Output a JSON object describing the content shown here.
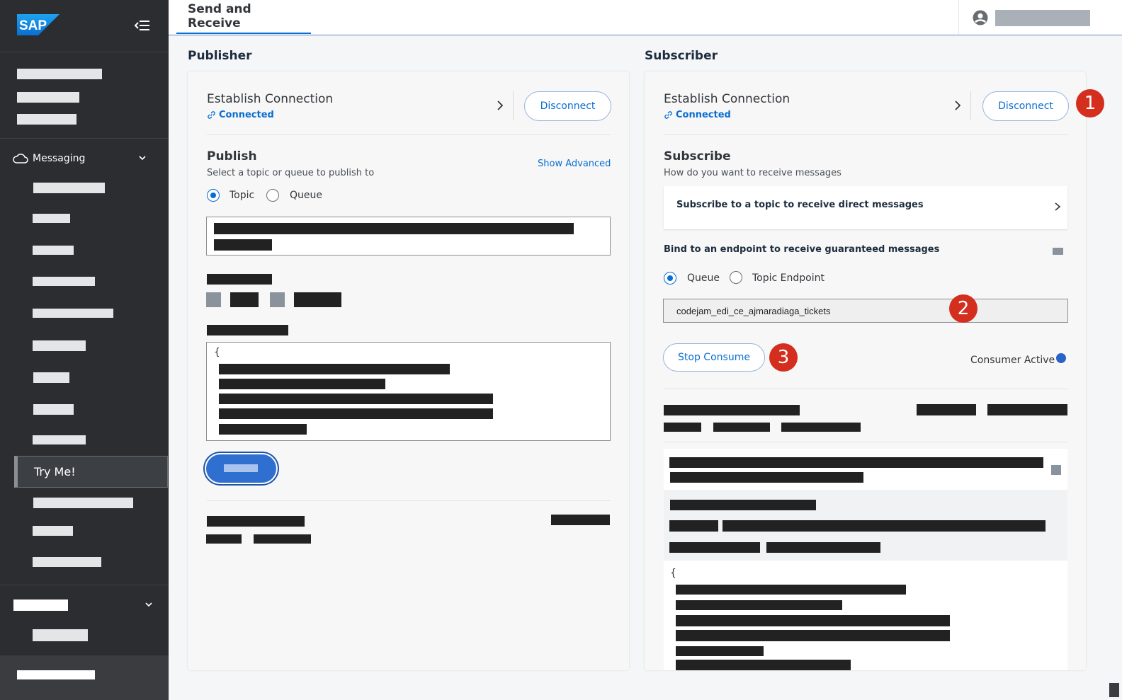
{
  "header": {
    "tab": "Send and Receive"
  },
  "sidebar": {
    "messaging_label": "Messaging",
    "active_item": "Try Me!"
  },
  "publisher": {
    "title": "Publisher",
    "connection_title": "Establish Connection",
    "connected": "Connected",
    "disconnect": "Disconnect",
    "publish_title": "Publish",
    "publish_sub": "Select a topic or queue to publish to",
    "show_advanced": "Show Advanced",
    "radio_topic": "Topic",
    "radio_queue": "Queue",
    "body_open_brace": "{"
  },
  "subscriber": {
    "title": "Subscriber",
    "connection_title": "Establish Connection",
    "connected": "Connected",
    "disconnect": "Disconnect",
    "subscribe_title": "Subscribe",
    "subscribe_sub": "How do you want to receive messages",
    "direct_option": "Subscribe to a topic to receive direct messages",
    "bind_title": "Bind to an endpoint to receive guaranteed messages",
    "radio_queue": "Queue",
    "radio_topic_endpoint": "Topic Endpoint",
    "queue_name": "codejam_edi_ce_ajmaradiaga_tickets",
    "stop_consume": "Stop Consume",
    "consumer_active": "Consumer Active",
    "message_open_brace": "{"
  },
  "annotations": [
    "1",
    "2",
    "3"
  ],
  "colors": {
    "accent": "#0a6ed1",
    "badge": "#d42e1f",
    "sidebar": "#2b2d30"
  }
}
